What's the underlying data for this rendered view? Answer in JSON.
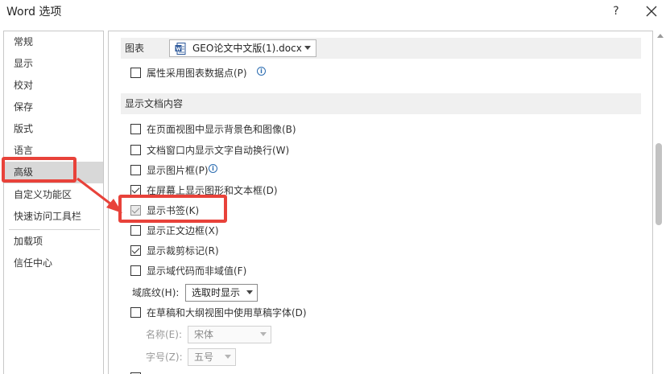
{
  "window": {
    "title": "Word 选项",
    "help_glyph": "?",
    "close_icon": "close-icon"
  },
  "sidebar": {
    "items": [
      {
        "label": "常规"
      },
      {
        "label": "显示"
      },
      {
        "label": "校对"
      },
      {
        "label": "保存"
      },
      {
        "label": "版式"
      },
      {
        "label": "语言"
      },
      {
        "label": "高级",
        "active": true
      },
      {
        "label": "自定义功能区"
      },
      {
        "label": "快速访问工具栏"
      },
      {
        "label": "加载项"
      },
      {
        "label": "信任中心"
      }
    ]
  },
  "chart_section": {
    "label": "图表",
    "document": "GEO论文中文版(1).docx",
    "doc_icon": "word-doc-icon"
  },
  "chart_options": [
    {
      "label": "属性采用图表数据点(P)",
      "checked": false,
      "info": true
    }
  ],
  "display_section": {
    "label": "显示文档内容"
  },
  "display_options": [
    {
      "label": "在页面视图中显示背景色和图像(B)",
      "checked": false
    },
    {
      "label": "文档窗口内显示文字自动换行(W)",
      "checked": false
    },
    {
      "label": "显示图片框(P)",
      "checked": false,
      "info": true
    },
    {
      "label": "在屏幕上显示图形和文本框(D)",
      "checked": true
    },
    {
      "label": "显示书签(K)",
      "checked": true,
      "disabled": true,
      "highlighted": true
    },
    {
      "label": "显示正文边框(X)",
      "checked": false
    },
    {
      "label": "显示裁剪标记(R)",
      "checked": true
    },
    {
      "label": "显示域代码而非域值(F)",
      "checked": false
    }
  ],
  "field_shading": {
    "label": "域底纹(H):",
    "value": "选取时显示"
  },
  "draft_font": {
    "label": "在草稿和大纲视图中使用草稿字体(D)",
    "checked": false,
    "name_label": "名称(E):",
    "name_value": "宋体",
    "size_label": "字号(Z):",
    "size_value": "五号"
  },
  "colors": {
    "highlight": "#e8423a",
    "active_nav": "#d8d8d8",
    "section_bg": "#f0f0f0"
  }
}
